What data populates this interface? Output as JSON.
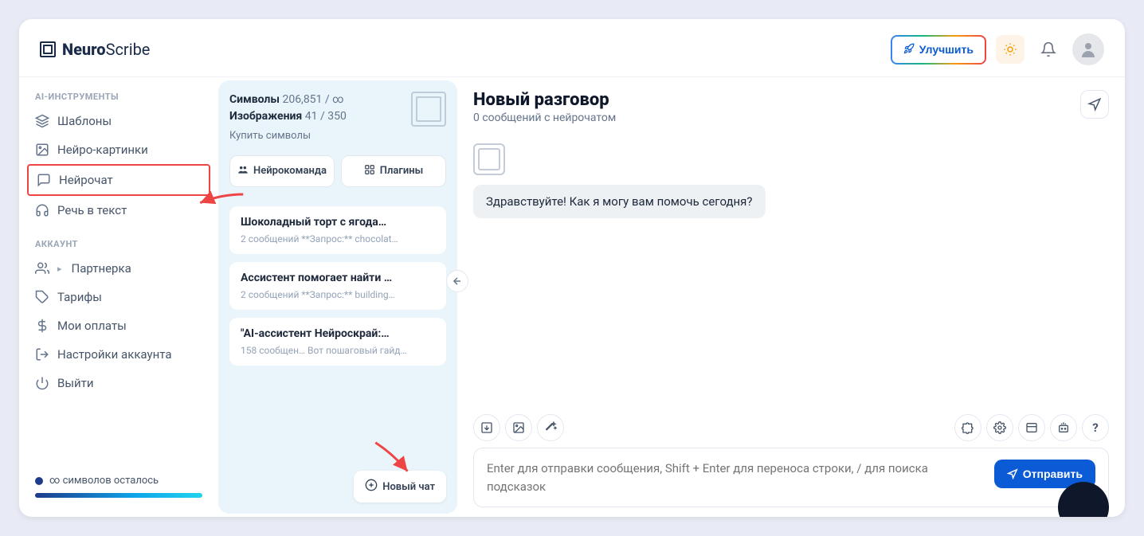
{
  "logo": {
    "strong": "Neuro",
    "light": "Scribe"
  },
  "header": {
    "upgrade": "Улучшить"
  },
  "sidebar": {
    "section_tools": "AI-ИНСТРУМЕНТЫ",
    "section_account": "АККАУНТ",
    "tools": [
      {
        "label": "Шаблоны"
      },
      {
        "label": "Нейро-картинки"
      },
      {
        "label": "Нейрочат"
      },
      {
        "label": "Речь в текст"
      }
    ],
    "account": [
      {
        "label": "Партнерка"
      },
      {
        "label": "Тарифы"
      },
      {
        "label": "Мои оплаты"
      },
      {
        "label": "Настройки аккаунта"
      },
      {
        "label": "Выйти"
      }
    ],
    "footer": "∞ символов осталось"
  },
  "mid": {
    "symbols_label": "Символы",
    "symbols_value": "206,851 / ∞",
    "images_label": "Изображения",
    "images_value": "41 / 350",
    "buy": "Купить символы",
    "btn_team": "Нейрокоманда",
    "btn_plugins": "Плагины",
    "chats": [
      {
        "title": "Шоколадный торт с ягода…",
        "sub": "2 сообщений   **Запрос:** chocolat…"
      },
      {
        "title": "Ассистент помогает найти …",
        "sub": "2 сообщений   **Запрос:** building…"
      },
      {
        "title": "\"AI-ассистент Нейроскрай:…",
        "sub": "158 сообщен… Вот пошаговый гайд…"
      }
    ],
    "new_chat": "Новый чат"
  },
  "main": {
    "title": "Новый разговор",
    "subtitle": "0 сообщений с нейрочатом",
    "greeting": "Здравствуйте! Как я могу вам помочь сегодня?",
    "placeholder": "Enter для отправки сообщения, Shift + Enter для переноса строки, / для поиска подсказок",
    "send": "Отправить"
  }
}
